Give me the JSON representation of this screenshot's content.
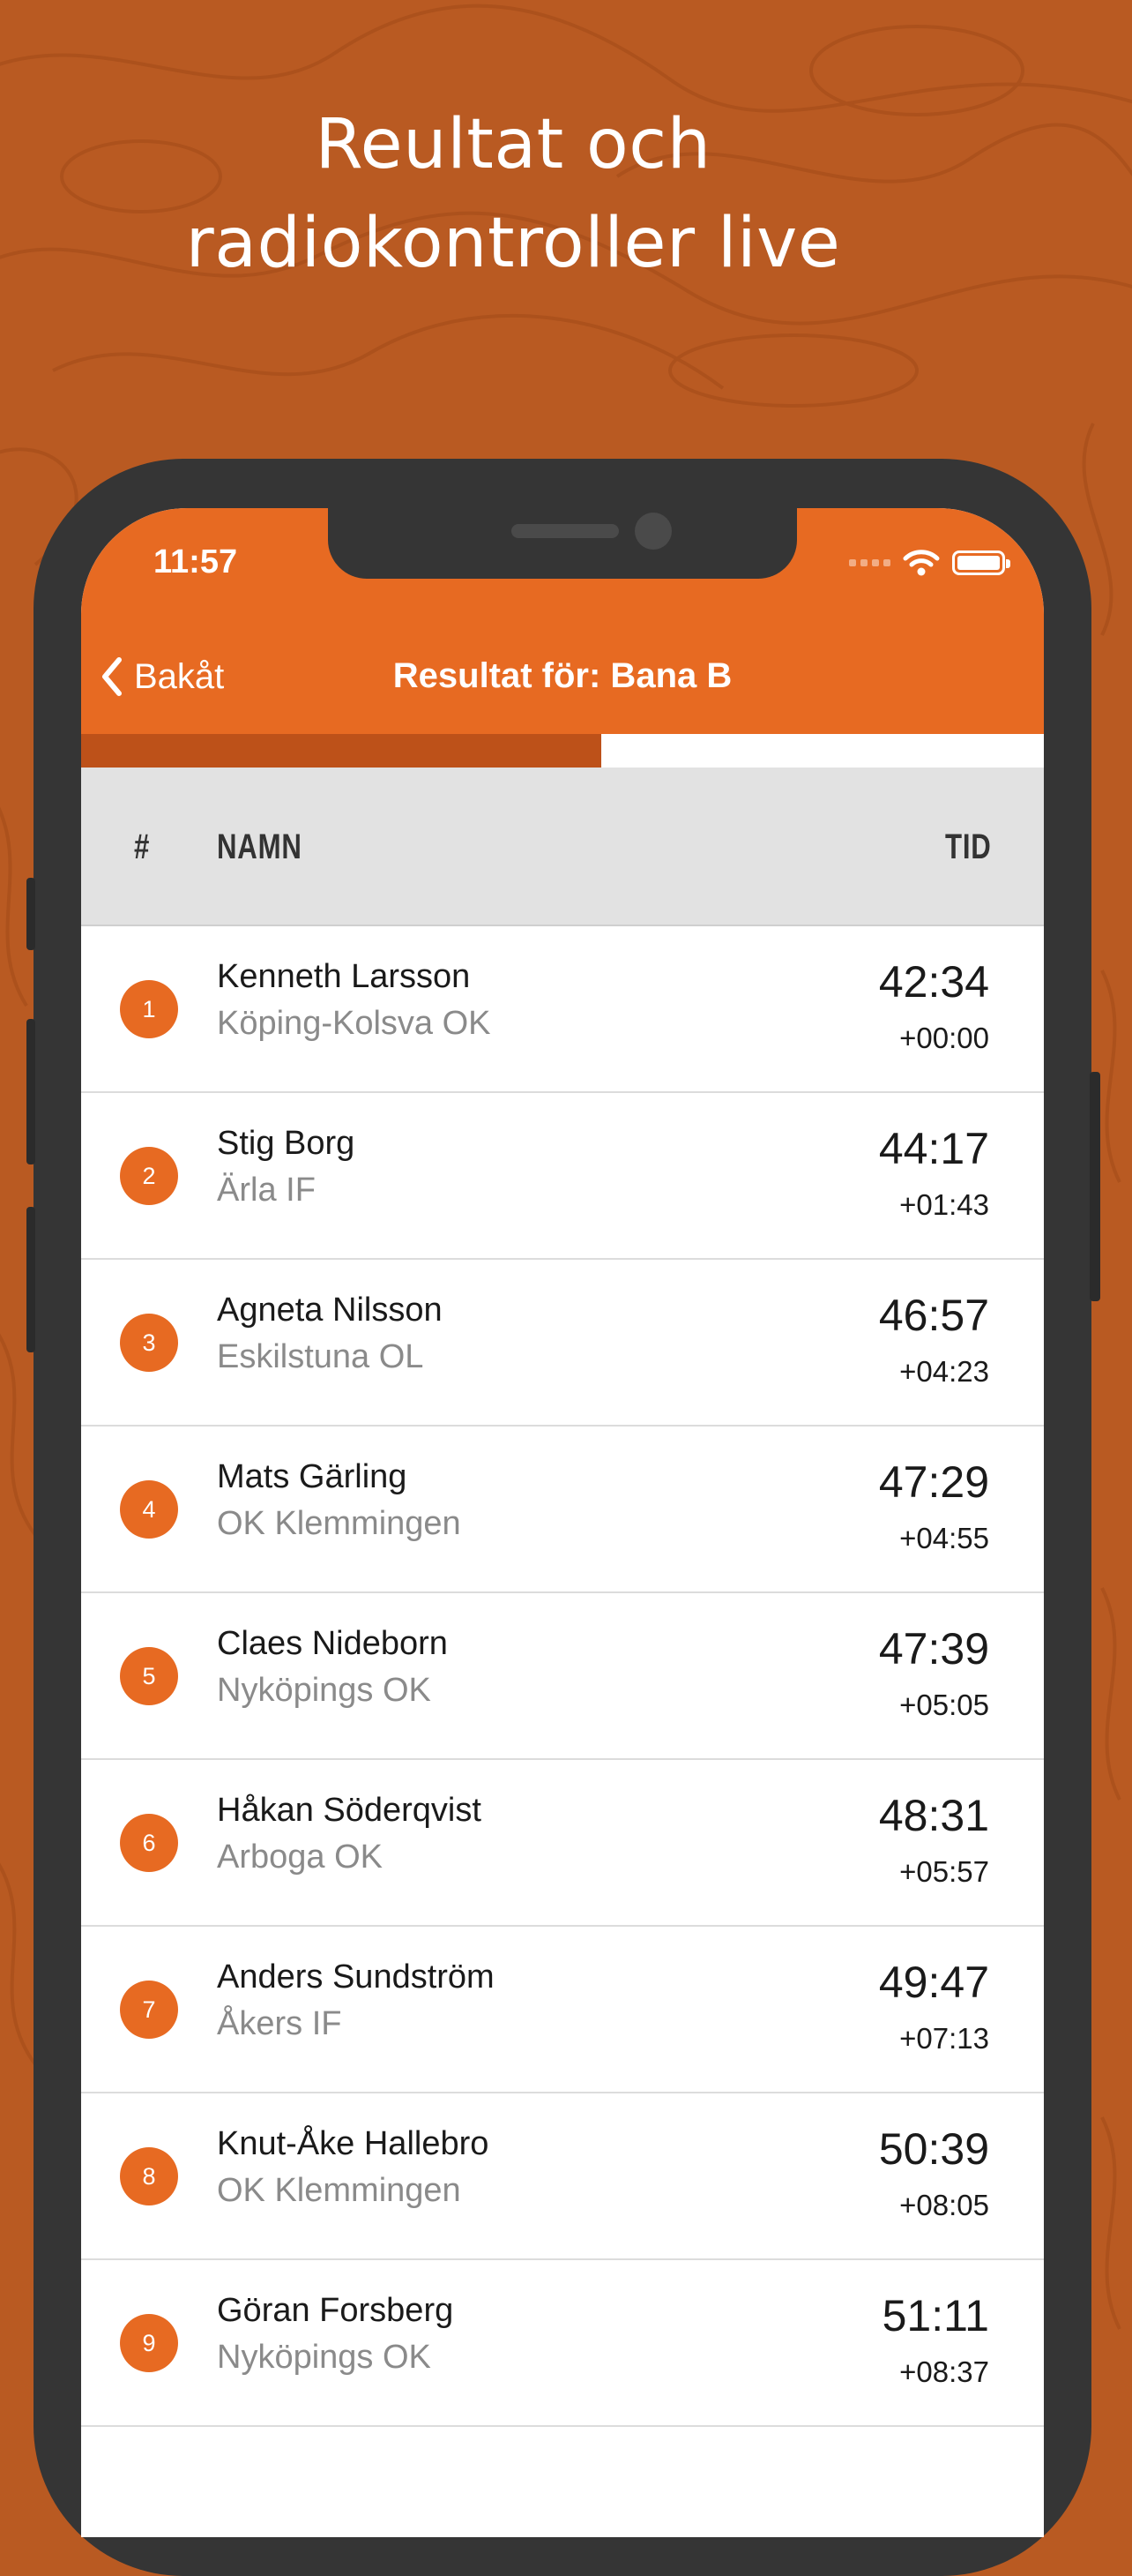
{
  "headline": {
    "line1": "Reultat och",
    "line2": "radiokontroller live"
  },
  "status_bar": {
    "time": "11:57"
  },
  "nav": {
    "back_label": "Bakåt",
    "title": "Resultat för: Bana B"
  },
  "progress": {
    "fraction": 0.54
  },
  "table": {
    "headers": {
      "rank": "#",
      "name": "NAMN",
      "time": "TID"
    },
    "rows": [
      {
        "rank": "1",
        "name": "Kenneth Larsson",
        "club": "Köping-Kolsva OK",
        "time": "42:34",
        "diff": "+00:00"
      },
      {
        "rank": "2",
        "name": "Stig Borg",
        "club": "Ärla IF",
        "time": "44:17",
        "diff": "+01:43"
      },
      {
        "rank": "3",
        "name": "Agneta Nilsson",
        "club": "Eskilstuna OL",
        "time": "46:57",
        "diff": "+04:23"
      },
      {
        "rank": "4",
        "name": "Mats Gärling",
        "club": "OK Klemmingen",
        "time": "47:29",
        "diff": "+04:55"
      },
      {
        "rank": "5",
        "name": "Claes Nideborn",
        "club": "Nyköpings OK",
        "time": "47:39",
        "diff": "+05:05"
      },
      {
        "rank": "6",
        "name": "Håkan Söderqvist",
        "club": "Arboga OK",
        "time": "48:31",
        "diff": "+05:57"
      },
      {
        "rank": "7",
        "name": "Anders Sundström",
        "club": "Åkers IF",
        "time": "49:47",
        "diff": "+07:13"
      },
      {
        "rank": "8",
        "name": "Knut-Åke Hallebro",
        "club": "OK Klemmingen",
        "time": "50:39",
        "diff": "+08:05"
      },
      {
        "rank": "9",
        "name": "Göran Forsberg",
        "club": "Nyköpings OK",
        "time": "51:11",
        "diff": "+08:37"
      }
    ]
  },
  "colors": {
    "accent": "#e76a22",
    "background": "#b95a22",
    "progress": "#bd5119"
  },
  "icons": {
    "back": "chevron-left-icon",
    "wifi": "wifi-icon",
    "battery": "battery-icon",
    "signal": "signal-icon"
  }
}
